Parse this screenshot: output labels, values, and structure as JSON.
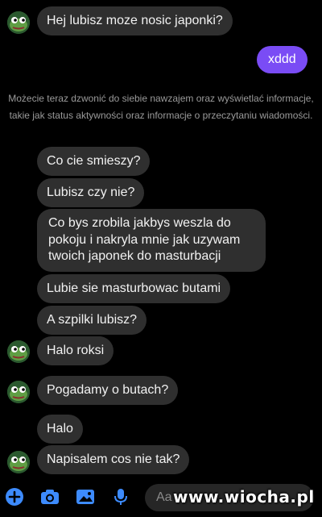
{
  "messages": [
    {
      "text": "Hej lubisz moze nosic japonki?"
    },
    {
      "text": "xddd"
    },
    {
      "text": "Co cie smieszy?"
    },
    {
      "text": "Lubisz czy nie?"
    },
    {
      "text": "Co bys zrobila jakbys weszla do pokoju i nakryla mnie jak uzywam twoich japonek do masturbacji"
    },
    {
      "text": "Lubie sie masturbowac butami"
    },
    {
      "text": "A szpilki lubisz?"
    },
    {
      "text": "Halo roksi"
    },
    {
      "text": "Pogadamy o butach?"
    },
    {
      "text": "Halo"
    },
    {
      "text": "Napisalem cos nie tak?"
    }
  ],
  "notice": "Możecie teraz dzwonić do siebie nawzajem oraz wyświetlać informacje, takie jak status aktywności oraz informacje o przeczytaniu wiadomości.",
  "composer": {
    "placeholder": "Aa",
    "icons": [
      "plus-icon",
      "camera-icon",
      "image-icon",
      "microphone-icon"
    ]
  },
  "watermark": "www.wiocha.pl",
  "colors": {
    "background": "#000000",
    "incoming_bubble": "#2f2f2f",
    "outgoing_bubble": "#7a4cf5",
    "accent": "#3d8bfd"
  }
}
